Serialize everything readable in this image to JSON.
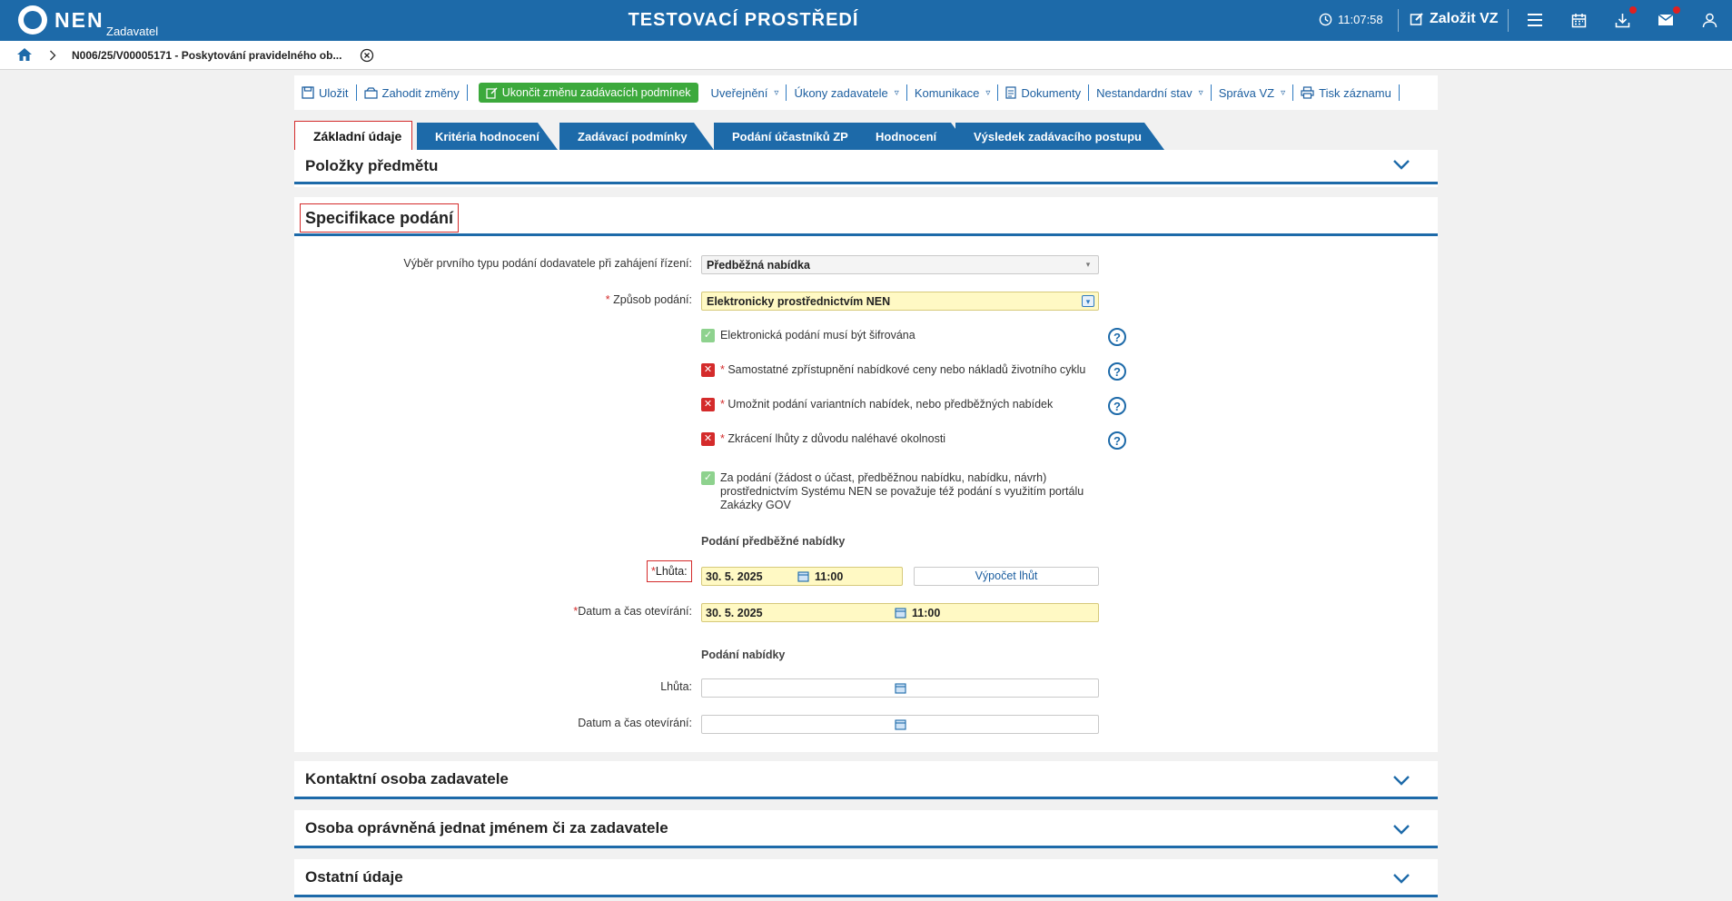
{
  "header": {
    "logo_text": "NEN",
    "logo_sub": "Zadavatel",
    "env_title": "TESTOVACÍ PROSTŘEDÍ",
    "clock": "11:07:58",
    "create_label": "Založit VZ"
  },
  "breadcrumb": {
    "item": "N006/25/V00005171 - Poskytování pravidelného ob..."
  },
  "toolbar": {
    "save": "Uložit",
    "discard": "Zahodit změny",
    "finish": "Ukončit změnu zadávacích podmínek",
    "publish": "Uveřejnění",
    "actions": "Úkony zadavatele",
    "communication": "Komunikace",
    "documents": "Dokumenty",
    "nonstandard": "Nestandardní stav",
    "admin": "Správa VZ",
    "print": "Tisk záznamu"
  },
  "tabs": [
    "Základní údaje",
    "Kritéria hodnocení",
    "Zadávací podmínky",
    "Podání účastníků ZP",
    "Hodnocení",
    "Výsledek zadávacího postupu"
  ],
  "panels": {
    "items": "Položky předmětu",
    "spec": "Specifikace podání",
    "contact": "Kontaktní osoba zadavatele",
    "authorized": "Osoba oprávněná jednat jménem či za zadavatele",
    "other": "Ostatní údaje"
  },
  "form": {
    "first_type_label": "Výběr prvního typu podání dodavatele při zahájení řízení:",
    "first_type_value": "Předběžná nabídka",
    "method_label": "Způsob podání:",
    "method_value": "Elektronicky prostřednictvím NEN",
    "checks": [
      {
        "label": "Elektronická podání musí být šifrována",
        "required": false,
        "checked": true
      },
      {
        "label": "Samostatné zpřístupnění nabídkové ceny nebo nákladů životního cyklu",
        "required": true,
        "checked": false
      },
      {
        "label": "Umožnit podání variantních nabídek, nebo předběžných nabídek",
        "required": true,
        "checked": false
      },
      {
        "label": "Zkrácení lhůty z důvodu naléhavé okolnosti",
        "required": true,
        "checked": false
      },
      {
        "label": "Za podání (žádost o účast, předběžnou nabídku, nabídku, návrh) prostřednictvím Systému NEN se považuje též podání s využitím portálu Zakázky GOV",
        "required": false,
        "checked": true
      }
    ],
    "prelim_head": "Podání předběžné nabídky",
    "deadline_label": "Lhůta:",
    "deadline_date": "30. 5. 2025",
    "deadline_time": "11:00",
    "calc_button": "Výpočet lhůt",
    "open_label": "Datum a čas otevírání:",
    "open_date": "30. 5. 2025",
    "open_time": "11:00",
    "offer_head": "Podání nabídky",
    "offer_deadline_label": "Lhůta:",
    "offer_open_label": "Datum a čas otevírání:"
  }
}
